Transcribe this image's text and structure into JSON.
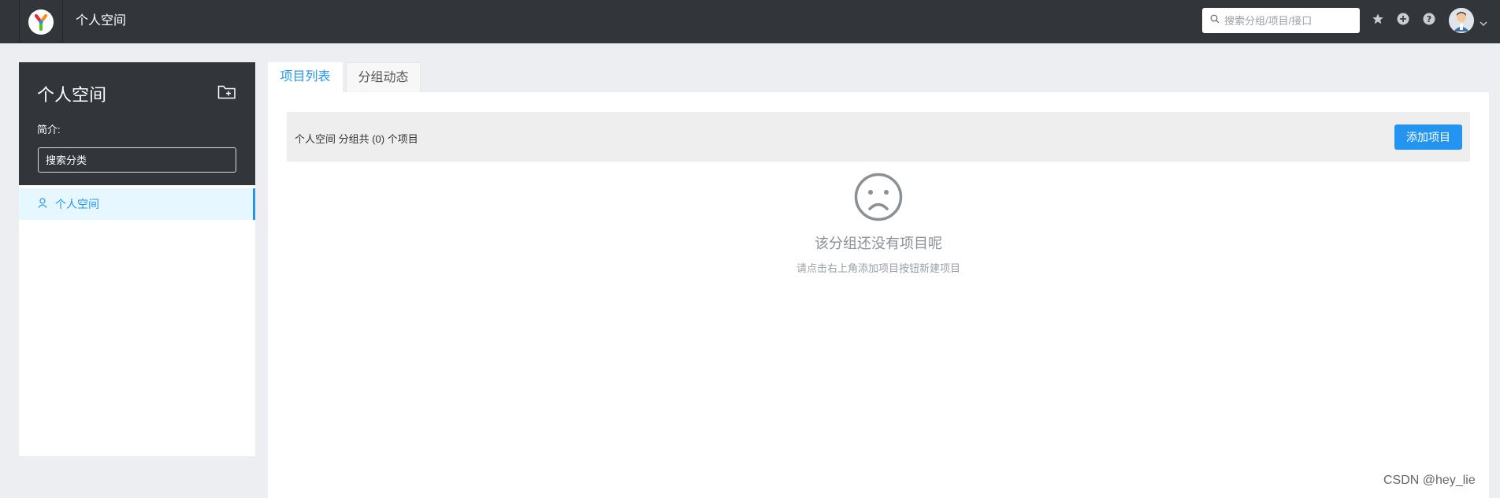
{
  "header": {
    "title": "个人空间",
    "search_placeholder": "搜索分组/项目/接口",
    "icons": [
      "star-icon",
      "plus-circle-icon",
      "question-circle-icon"
    ],
    "avatar": "user-avatar"
  },
  "sidebar": {
    "title": "个人空间",
    "desc_label": "简介:",
    "search_placeholder": "搜索分类",
    "items": [
      {
        "label": "个人空间",
        "icon": "user-icon",
        "active": true
      }
    ]
  },
  "tabs": [
    {
      "label": "项目列表",
      "active": true
    },
    {
      "label": "分组动态",
      "active": false
    }
  ],
  "main": {
    "project_count_text": "个人空间 分组共 (0) 个项目",
    "add_button_label": "添加项目",
    "empty_title": "该分组还没有项目呢",
    "empty_subtitle": "请点击右上角添加项目按钮新建项目"
  },
  "watermark": "CSDN @hey_lie",
  "colors": {
    "topbar": "#32363b",
    "accent": "#2395f1",
    "page_bg": "#eceef1"
  }
}
